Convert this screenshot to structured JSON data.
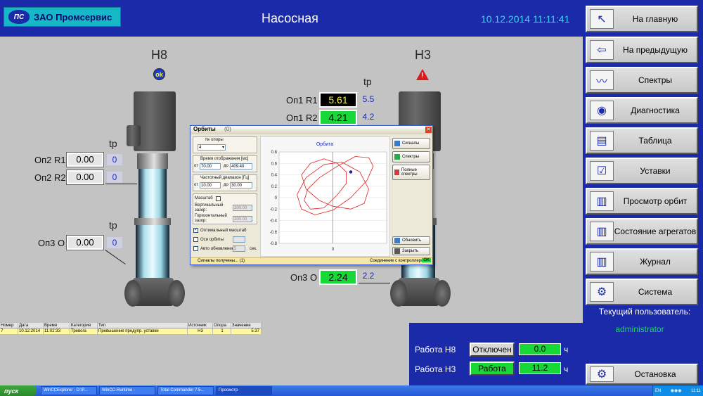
{
  "header": {
    "company": "ЗАО Промсервис",
    "logo_text": "ПС",
    "title": "Насосная",
    "datetime": "10.12.2014 11:11:41"
  },
  "nav": {
    "items": [
      {
        "label": "На главную",
        "icon": "arrow-up-left-icon"
      },
      {
        "label": "На предыдущую",
        "icon": "arrow-left-icon"
      },
      {
        "label": "Спектры",
        "icon": "spectrum-icon"
      },
      {
        "label": "Диагностика",
        "icon": "diagnostics-icon"
      },
      {
        "label": "Таблица",
        "icon": "table-icon"
      },
      {
        "label": "Уставки",
        "icon": "settings-list-icon"
      },
      {
        "label": "Просмотр орбит",
        "icon": "orbit-view-icon"
      },
      {
        "label": "Состояние агрегатов",
        "icon": "units-state-icon"
      },
      {
        "label": "Журнал",
        "icon": "journal-icon"
      },
      {
        "label": "Система",
        "icon": "system-icon"
      }
    ],
    "user_caption": "Текущий пользователь:",
    "user_name": "administrator",
    "stop_label": "Остановка"
  },
  "pumps": {
    "h8": {
      "name": "Н8",
      "status": "ok",
      "tp_label": "tp",
      "op2_r1_label": "Оп2 R1",
      "op2_r1_value": "0.00",
      "op2_r1_tp": "0",
      "op2_r2_label": "Оп2 R2",
      "op2_r2_value": "0.00",
      "op2_r2_tp": "0",
      "op3_o_label": "Оп3 О",
      "op3_o_value": "0.00",
      "op3_o_tp": "0"
    },
    "h3": {
      "name": "Н3",
      "tp_label": "tp",
      "op1_r1_label": "Оп1 R1",
      "op1_r1_value": "5.61",
      "op1_r1_tp": "5.5",
      "op1_r2_label": "Оп1 R2",
      "op1_r2_value": "4.21",
      "op1_r2_tp": "4.2",
      "op3_o_label": "Оп3 О",
      "op3_o_value": "2.24",
      "op3_o_tp": "2.2"
    }
  },
  "dialog": {
    "title": "Орбиты",
    "title_suffix": "(0)",
    "support_label": "№ опоры",
    "support_value": "4",
    "time_label": "Время отображения [мс]",
    "from_label": "от",
    "to_label": "до",
    "time_from": "70.00",
    "time_to": "409.40",
    "freq_label": "Частотный диапазон [Гц]",
    "freq_from": "10.00",
    "freq_to": "30.00",
    "scale_label": "Масштаб",
    "vgap_label": "Вертикальный зазор:",
    "vgap_value": "200.00",
    "hgap_label": "Горизонтальный зазор:",
    "hgap_value": "200.00",
    "opt_scale_label": "Оптимальный масштаб",
    "axes_label": "Оси орбиты",
    "auto_update_label": "Авто обновление",
    "auto_update_value": "5",
    "sec_label": "сек.",
    "btn_signals": "Сигналы",
    "btn_spectra": "Спектры",
    "btn_full_spectra": "Полные спектры",
    "btn_refresh": "Обновить",
    "btn_close": "Закрыть",
    "status_left": "Сигналы получены... (1)",
    "status_right": "Соединение с контроллером",
    "status_ok": "OK"
  },
  "chart_data": {
    "type": "line",
    "title": "Орбита",
    "xlabel": "",
    "ylabel": "",
    "ylim": [
      -0.8,
      0.8
    ],
    "yticks": [
      "0.8",
      "0.6",
      "0.4",
      "0.2",
      "0",
      "-0.2",
      "-0.4",
      "-0.6",
      "-0.8"
    ],
    "xticks": [
      "0"
    ],
    "grid": true,
    "series_color": "#e02020",
    "series": [
      {
        "x": [
          0.15,
          0.05,
          -0.1,
          -0.25,
          -0.35,
          -0.3,
          -0.15,
          0.0,
          0.2,
          0.35,
          0.4,
          0.3,
          0.1,
          -0.1,
          -0.3,
          -0.4,
          -0.35,
          -0.2,
          0.0,
          0.2,
          0.38,
          0.45,
          0.4,
          0.25,
          0.05,
          -0.15,
          -0.28,
          -0.32,
          -0.25,
          -0.1,
          0.05,
          0.15
        ],
        "y": [
          0.45,
          0.6,
          0.68,
          0.6,
          0.4,
          0.15,
          -0.05,
          -0.15,
          -0.2,
          -0.1,
          0.15,
          0.45,
          0.62,
          0.58,
          0.35,
          0.05,
          -0.2,
          -0.3,
          -0.22,
          0.0,
          0.3,
          0.55,
          0.7,
          0.72,
          0.55,
          0.35,
          0.15,
          -0.05,
          -0.2,
          -0.18,
          0.05,
          0.25
        ]
      }
    ],
    "current_point": {
      "x": 0.2,
      "y": 0.45
    }
  },
  "alarm_table": {
    "headers": [
      "Номер",
      "Дата",
      "Время",
      "Категория",
      "Тип",
      "Источник",
      "Опора",
      "Значение"
    ],
    "rows": [
      [
        "7",
        "10.12.2014",
        "11:02:33",
        "Тревога",
        "Превышение предупр. уставки",
        "Н3",
        "1",
        "5.37"
      ]
    ]
  },
  "status": {
    "h8_label": "Работа Н8",
    "h8_state": "Отключен",
    "h8_hours": "0.0",
    "h3_label": "Работа Н3",
    "h3_state": "Работа",
    "h3_hours": "11.2",
    "unit": "ч"
  },
  "taskbar": {
    "start": "пуск",
    "tasks": [
      "WinCCExplorer - D:\\P...",
      "WinCC-Runtime -",
      "Total Commander 7.5...",
      "Просмотр"
    ],
    "lang": "EN",
    "clock": "11:11"
  },
  "colors": {
    "header_blue": "#1a2aa8",
    "ok_green": "#18d838",
    "alarm_red": "#e01818",
    "trace_red": "#e02020"
  }
}
